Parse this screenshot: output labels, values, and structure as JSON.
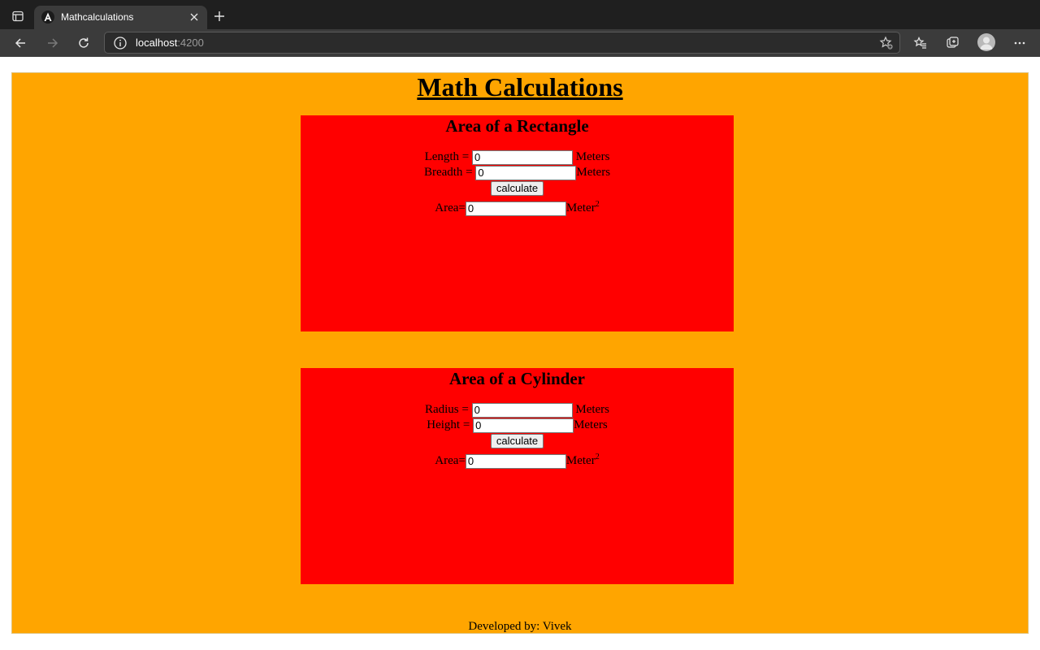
{
  "browser": {
    "tab": {
      "title": "Mathcalculations"
    },
    "address": {
      "host": "localhost",
      "port": ":4200"
    },
    "icons": [
      "tab-actions-icon",
      "angular-favicon-icon",
      "close-icon",
      "plus-icon",
      "back-icon",
      "forward-icon",
      "reload-icon",
      "info-icon",
      "add-favorite-icon",
      "favorites-icon",
      "collections-icon",
      "profile-icon",
      "more-icon"
    ]
  },
  "page": {
    "title": "Math Calculations",
    "rectangle": {
      "heading": "Area of a Rectangle",
      "length_label": "Length = ",
      "length_value": "0",
      "length_unit": " Meters",
      "breadth_label": "Breadth = ",
      "breadth_value": "0",
      "breadth_unit": "Meters",
      "button": "calculate",
      "area_label": "Area=",
      "area_value": "0",
      "area_unit": "Meter",
      "area_exp": "2"
    },
    "cylinder": {
      "heading": "Area of a Cylinder",
      "radius_label": "Radius = ",
      "radius_value": "0",
      "radius_unit": " Meters",
      "height_label": "Height = ",
      "height_value": "0",
      "height_unit": "Meters",
      "button": "calculate",
      "area_label": "Area=",
      "area_value": "0",
      "area_unit": "Meter",
      "area_exp": "2"
    },
    "footer": "Developed by: Vivek"
  },
  "colors": {
    "page_bg": "#ffa500",
    "card_bg": "#ff0000"
  }
}
